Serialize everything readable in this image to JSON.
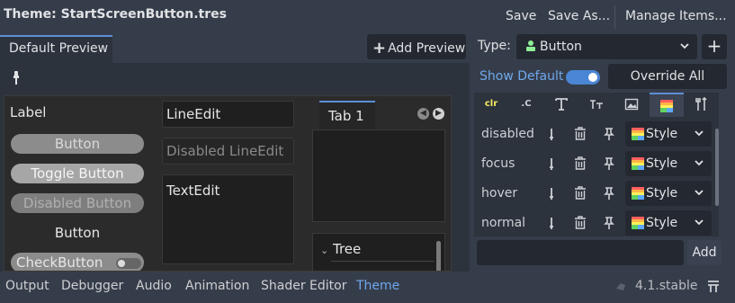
{
  "header": {
    "title": "Theme: StartScreenButton.tres",
    "save": "Save",
    "save_as": "Save As...",
    "manage_items": "Manage Items..."
  },
  "preview": {
    "tab_label": "Default Preview",
    "add_preview": "Add Preview",
    "controls": {
      "label": "Label",
      "button": "Button",
      "toggle_button": "Toggle Button",
      "disabled_button": "Disabled Button",
      "flat_button": "Button",
      "check_button": "CheckButton",
      "line_edit": "LineEdit",
      "disabled_line_edit": "Disabled LineEdit",
      "text_edit": "TextEdit",
      "tab": "Tab 1",
      "tree": "Tree"
    }
  },
  "inspector": {
    "type_label": "Type:",
    "type_value": "Button",
    "show_default": "Show Default",
    "show_default_on": true,
    "override_all": "Override All",
    "data_tabs": [
      {
        "name": "color",
        "text": "clr",
        "active": false
      },
      {
        "name": "constant",
        "text": ".C",
        "active": false
      },
      {
        "name": "font",
        "icon": "font-icon",
        "active": false
      },
      {
        "name": "font-size",
        "icon": "font-size-icon",
        "active": false
      },
      {
        "name": "icon",
        "icon": "image-icon",
        "active": false
      },
      {
        "name": "stylebox",
        "icon": "stylebox-icon",
        "active": true
      },
      {
        "name": "type-variation",
        "icon": "tools-icon",
        "active": false
      }
    ],
    "items": [
      {
        "name": "disabled",
        "value": "Style"
      },
      {
        "name": "focus",
        "value": "Style"
      },
      {
        "name": "hover",
        "value": "Style"
      },
      {
        "name": "normal",
        "value": "Style"
      }
    ],
    "add_button": "Add"
  },
  "bottom_panel": {
    "tabs": [
      "Output",
      "Debugger",
      "Audio",
      "Animation",
      "Shader Editor",
      "Theme"
    ],
    "active_tab": "Theme",
    "version": "4.1.stable"
  },
  "colors": {
    "accent": "#5c8fd6",
    "link_text": "#6ea8ec",
    "editor_bg": "#363d4a",
    "panel_bg": "#2d333d",
    "preview_bg": "#2b2b2b"
  }
}
